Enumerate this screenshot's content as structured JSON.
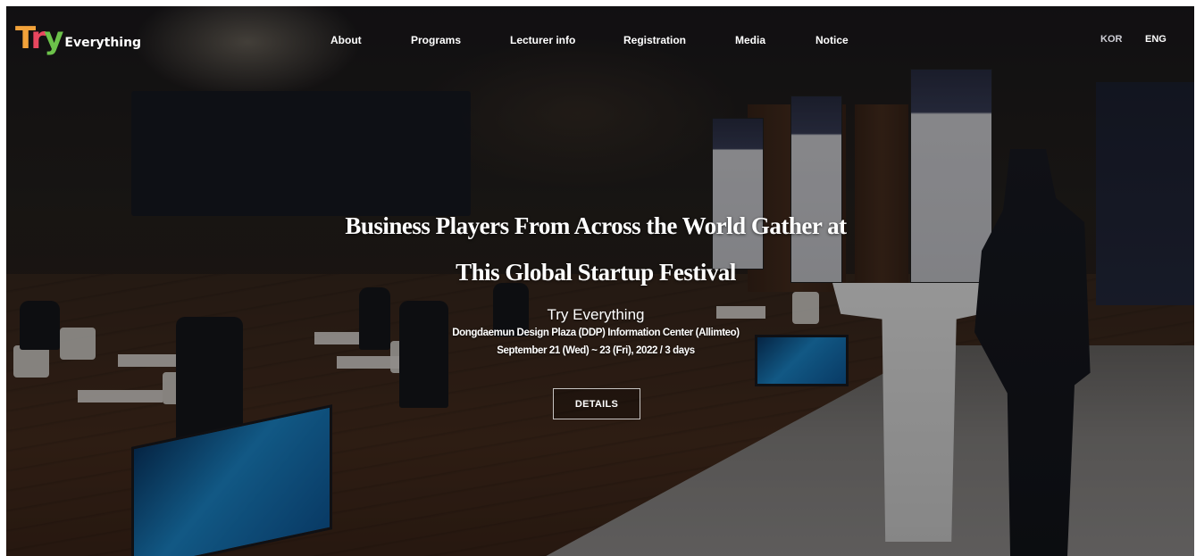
{
  "header": {
    "logo": {
      "mark": "Try",
      "word": "Everything"
    },
    "nav": [
      {
        "id": "about",
        "label": "About"
      },
      {
        "id": "programs",
        "label": "Programs"
      },
      {
        "id": "lecturer",
        "label": "Lecturer info"
      },
      {
        "id": "registration",
        "label": "Registration"
      },
      {
        "id": "media",
        "label": "Media"
      },
      {
        "id": "notice",
        "label": "Notice"
      }
    ],
    "languages": {
      "kor": "KOR",
      "eng": "ENG",
      "active": "ENG"
    }
  },
  "hero": {
    "headline_line1": "Business Players From Across the World Gather at",
    "headline_line2": "This Global Startup Festival",
    "event_name": "Try Everything",
    "venue": "Dongdaemun Design Plaza (DDP) Information Center (Allimteo)",
    "dates": "September 21 (Wed) ~ 23 (Fri), 2022 / 3 days",
    "details_button": "DETAILS"
  },
  "colors": {
    "logo_t": "#f2a23a",
    "logo_r": "#e8475f",
    "logo_y": "#6cc24a",
    "text": "#ffffff",
    "lang_inactive": "#cfcfd6"
  }
}
